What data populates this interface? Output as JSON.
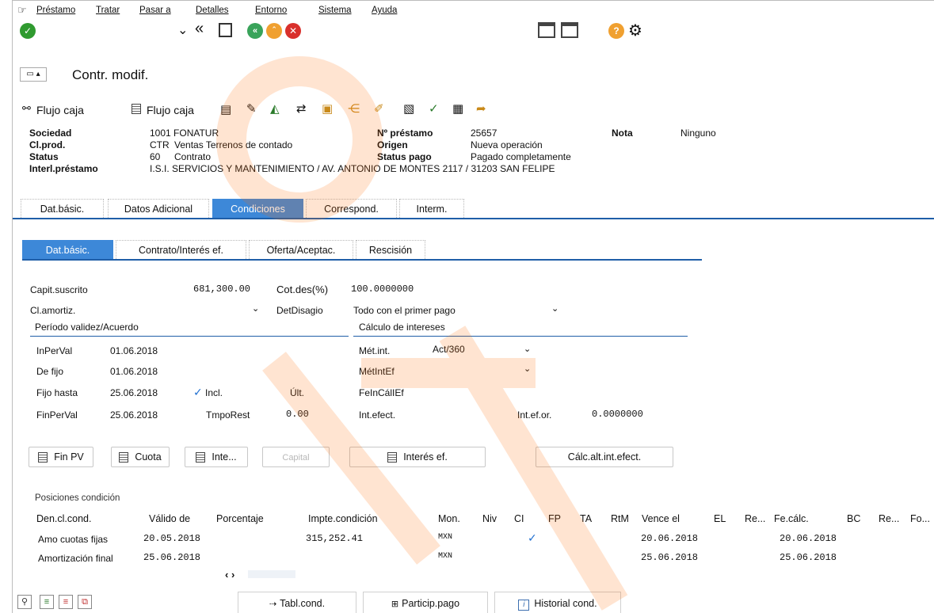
{
  "menu": [
    "Préstamo",
    "Tratar",
    "Pasar a",
    "Detalles",
    "Entorno",
    "Sistema",
    "Ayuda"
  ],
  "title": "Contr. modif.",
  "actions": {
    "flujo_caja_1": "Flujo caja",
    "flujo_caja_2": "Flujo caja"
  },
  "header": {
    "sociedad_label": "Sociedad",
    "sociedad_value": "1001 FONATUR",
    "clprod_label": "Cl.prod.",
    "clprod_code": "CTR",
    "clprod_value": "Ventas Terrenos de contado",
    "status_label": "Status",
    "status_code": "60",
    "status_value": "Contrato",
    "interl_label": "Interl.préstamo",
    "interl_value": "I.S.I. SERVICIOS Y MANTENIMIENTO / AV. ANTONIO DE MONTES 2117 / 31203 SAN FELIPE",
    "nprestamo_label": "Nº préstamo",
    "nprestamo_value": "25657",
    "origen_label": "Origen",
    "origen_value": "Nueva operación",
    "statuspago_label": "Status pago",
    "statuspago_value": "Pagado completamente",
    "nota_label": "Nota",
    "nota_value": "Ninguno"
  },
  "main_tabs": [
    "Dat.básic.",
    "Datos Adicional",
    "Condiciones",
    "Correspond.",
    "Interm."
  ],
  "sub_tabs": [
    "Dat.básic.",
    "Contrato/Interés ef.",
    "Oferta/Aceptac.",
    "Rescisión"
  ],
  "form": {
    "capit_label": "Capit.suscrito",
    "capit_value": "681,300.00",
    "cotdes_label": "Cot.des(%)",
    "cotdes_value": "100.0000000",
    "clamortiz_label": "Cl.amortiz.",
    "detdisagio_label": "DetDisagio",
    "detdisagio_value": "Todo con el primer pago",
    "periodo_title": "Período validez/Acuerdo",
    "calculo_title": "Cálculo de intereses",
    "inperval_label": "InPerVal",
    "inperval_value": "01.06.2018",
    "defijo_label": "De fijo",
    "defijo_value": "01.06.2018",
    "fijohasta_label": "Fijo hasta",
    "fijohasta_value": "25.06.2018",
    "incl_check": "✓",
    "incl_label": "Incl.",
    "ult_label": "Últ.",
    "finperval_label": "FinPerVal",
    "finperval_value": "25.06.2018",
    "tmporest_label": "TmpoRest",
    "tmporest_value": "0.00",
    "metint_label": "Mét.int.",
    "metint_value": "Act/360",
    "metintef_label": "MétIntEf",
    "feincallef_label": "FeInCálIEf",
    "intefect_label": "Int.efect.",
    "intefor_label": "Int.ef.or.",
    "intefor_value": "0.0000000"
  },
  "buttons": {
    "finpv": "Fin PV",
    "cuota": "Cuota",
    "inte": "Inte...",
    "capital": "Capital",
    "interes_ef": "Interés ef.",
    "calc_alt": "Cálc.alt.int.efect."
  },
  "positions": {
    "title": "Posiciones condición",
    "columns": [
      "Den.cl.cond.",
      "Válido de",
      "Porcentaje",
      "Impte.condición",
      "Mon.",
      "Niv",
      "CI",
      "FP",
      "TA",
      "RtM",
      "Vence el",
      "EL",
      "Re...",
      "Fe.cálc.",
      "BC",
      "Re...",
      "Fo..."
    ],
    "rows": [
      {
        "den": "Amo cuotas fijas",
        "valido": "20.05.2018",
        "importe": "315,252.41",
        "mon": "MXN",
        "ci": "✓",
        "vence": "20.06.2018",
        "fecalc": "20.06.2018"
      },
      {
        "den": "Amortización final",
        "valido": "25.06.2018",
        "importe": "",
        "mon": "MXN",
        "ci": "",
        "vence": "25.06.2018",
        "fecalc": "25.06.2018"
      }
    ],
    "scroll": "‹ ›"
  },
  "bottom_tabs": [
    "Tabl.cond.",
    "Particip.pago",
    "Historial cond."
  ],
  "colors": {
    "accent": "#3d88d8",
    "line": "#1f5ea8",
    "ok_green": "#2f9a2f",
    "nav_green": "#39a35a",
    "orange": "#f0a030",
    "red": "#d9302c"
  }
}
